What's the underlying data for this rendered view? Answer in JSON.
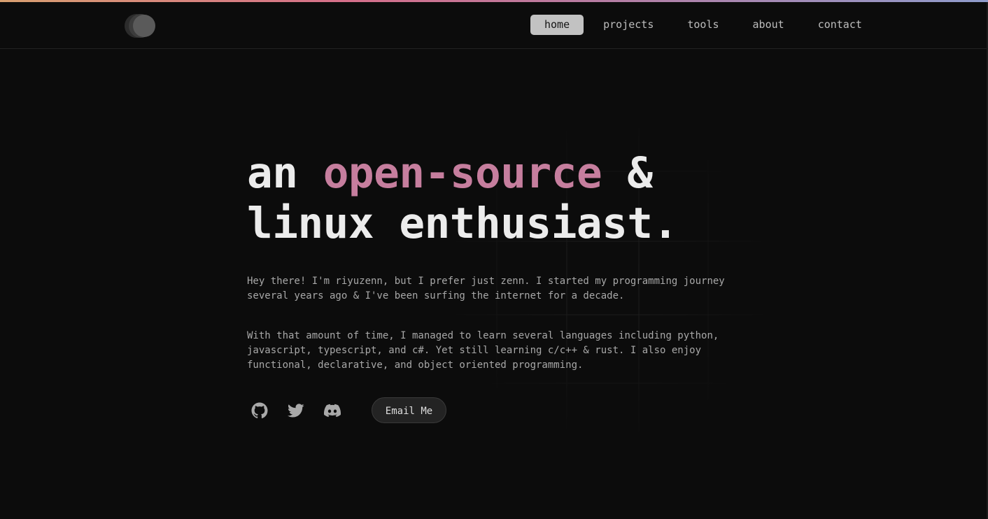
{
  "header": {
    "nav": [
      {
        "label": "home",
        "active": true
      },
      {
        "label": "projects",
        "active": false
      },
      {
        "label": "tools",
        "active": false
      },
      {
        "label": "about",
        "active": false
      },
      {
        "label": "contact",
        "active": false
      }
    ]
  },
  "hero": {
    "line1_prefix": "an ",
    "line1_accent": "open-source",
    "line1_suffix": " &",
    "line2": "linux enthusiast."
  },
  "intro": {
    "paragraph1": "Hey there! I'm riyuzenn, but I prefer just zenn. I started my programming journey several years ago & I've been surfing the internet for a decade.",
    "paragraph2": "With that amount of time, I managed to learn several languages including python, javascript, typescript, and c#. Yet still learning c/c++ & rust. I also enjoy functional, declarative, and object oriented programming."
  },
  "socials": [
    {
      "icon": "github-icon"
    },
    {
      "icon": "twitter-icon"
    },
    {
      "icon": "discord-icon"
    }
  ],
  "cta": {
    "email_label": "Email Me"
  },
  "colors": {
    "background": "#0c0c0c",
    "accent": "#c67e9e",
    "nav_active_bg": "#c2c2c2",
    "text_primary": "#ececec",
    "text_muted": "#a8a8a8"
  }
}
